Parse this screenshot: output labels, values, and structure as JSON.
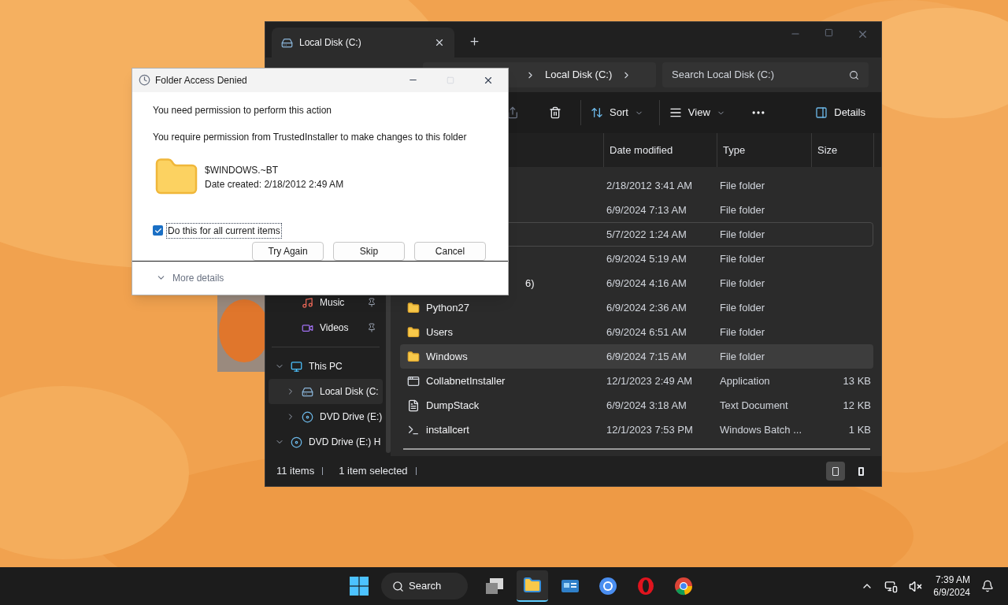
{
  "explorer": {
    "tab": {
      "title": "Local Disk (C:)",
      "selected": true
    },
    "breadcrumb": [
      "Local Disk (C:)"
    ],
    "search": {
      "placeholder": "Search Local Disk (C:)"
    },
    "toolbar": [
      {
        "kind": "share"
      },
      {
        "kind": "delete"
      },
      {
        "kind": "sort",
        "label": "Sort"
      },
      {
        "kind": "view",
        "label": "View"
      },
      {
        "kind": "more"
      },
      {
        "kind": "details",
        "label": "Details"
      }
    ],
    "columns": [
      "Date modified",
      "Type",
      "Size"
    ],
    "rows": [
      {
        "date": "2/18/2012 3:41 AM",
        "type": "File folder",
        "selected": false,
        "focused": false
      },
      {
        "date": "6/9/2024 7:13 AM",
        "type": "File folder",
        "selected": false,
        "focused": false
      },
      {
        "date": "5/7/2022 1:24 AM",
        "type": "File folder",
        "selected": false,
        "focused": true
      },
      {
        "date": "6/9/2024 5:19 AM",
        "type": "File folder",
        "selected": false,
        "focused": false
      },
      {
        "name": "6)",
        "date": "6/9/2024 4:16 AM",
        "type": "File folder",
        "selected": false,
        "focused": false
      },
      {
        "name": "Python27",
        "kind": "folder",
        "date": "6/9/2024 2:36 AM",
        "type": "File folder",
        "selected": false,
        "focused": false
      },
      {
        "name": "Users",
        "kind": "folder",
        "date": "6/9/2024 6:51 AM",
        "type": "File folder",
        "selected": false,
        "focused": false
      },
      {
        "name": "Windows",
        "kind": "folder",
        "date": "6/9/2024 7:15 AM",
        "type": "File folder",
        "selected": true,
        "focused": false
      },
      {
        "name": "CollabnetInstaller",
        "kind": "app",
        "date": "12/1/2023 2:49 AM",
        "type": "Application",
        "size": "13 KB",
        "selected": false,
        "focused": false
      },
      {
        "name": "DumpStack",
        "kind": "text",
        "date": "6/9/2024 3:18 AM",
        "type": "Text Document",
        "size": "12 KB",
        "selected": false,
        "focused": false
      },
      {
        "name": "installcert",
        "kind": "batch",
        "date": "12/1/2023 7:53 PM",
        "type": "Windows Batch ...",
        "size": "1 KB",
        "selected": false,
        "focused": false
      }
    ],
    "sidebar": [
      {
        "label": "Music",
        "kind": "music",
        "pinned": true
      },
      {
        "label": "Videos",
        "kind": "video",
        "pinned": true
      },
      {
        "label": "This PC",
        "kind": "pc",
        "expanded": true,
        "children": [
          {
            "label": "Local Disk (C:",
            "kind": "drive",
            "expanded": false,
            "selected": true
          },
          {
            "label": "DVD Drive (E:)",
            "kind": "dvd",
            "expanded": false,
            "selected": false
          }
        ]
      },
      {
        "label": "DVD Drive (E:) H",
        "kind": "dvd",
        "expanded": true,
        "selected": false
      }
    ],
    "status": [
      "11 items",
      "1 item selected"
    ],
    "views": [
      {
        "kind": "details",
        "selected": true
      },
      {
        "kind": "tiles",
        "selected": false
      }
    ]
  },
  "dialog": {
    "title": "Folder Access Denied",
    "heading": "You need permission to perform this action",
    "message": "You require permission from TrustedInstaller to make changes to this folder",
    "file": {
      "name": "$WINDOWS.~BT",
      "created": "Date created: 2/18/2012 2:49 AM"
    },
    "checkbox": {
      "label": "Do this for all current items",
      "checked": true
    },
    "buttons": [
      "Try Again",
      "Skip",
      "Cancel"
    ],
    "more_details": {
      "label": "More details",
      "expanded": false
    }
  },
  "taskbar": {
    "search": "Search",
    "apps": [
      {
        "kind": "taskview",
        "selected": false
      },
      {
        "kind": "explorer",
        "selected": true
      },
      {
        "kind": "control",
        "selected": false
      },
      {
        "kind": "chromium",
        "selected": false
      },
      {
        "kind": "opera",
        "selected": false
      },
      {
        "kind": "chrome",
        "selected": false
      }
    ],
    "time": "7:39 AM",
    "date": "6/9/2024"
  }
}
